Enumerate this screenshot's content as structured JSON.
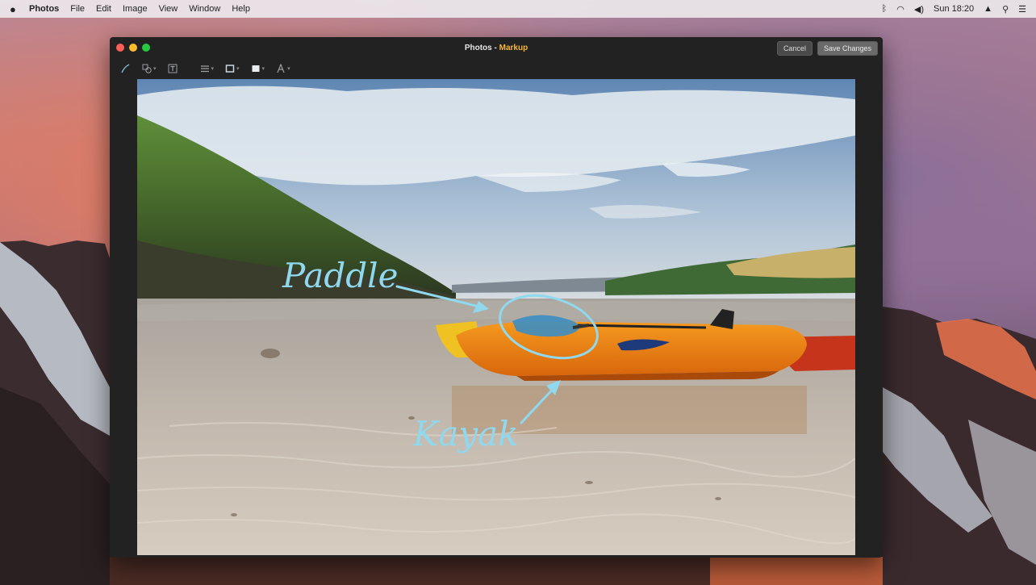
{
  "menubar": {
    "apple_icon": "apple-logo-icon",
    "app_name": "Photos",
    "items": [
      "File",
      "Edit",
      "Image",
      "View",
      "Window",
      "Help"
    ],
    "clock": "Sun 18:20"
  },
  "window": {
    "title_app": "Photos",
    "title_separator": " - ",
    "title_mode": "Markup",
    "cancel_label": "Cancel",
    "save_label": "Save Changes"
  },
  "toolbar": {
    "icons": [
      "sketch-icon",
      "shapes-icon",
      "text-icon",
      "line-style-icon",
      "border-color-icon",
      "fill-color-icon",
      "text-style-icon"
    ]
  },
  "annotations": {
    "paddle_label": "Paddle",
    "kayak_label": "Kayak"
  },
  "colors": {
    "markup_accent": "#8fd8ee",
    "title_accent": "#f5b732"
  }
}
